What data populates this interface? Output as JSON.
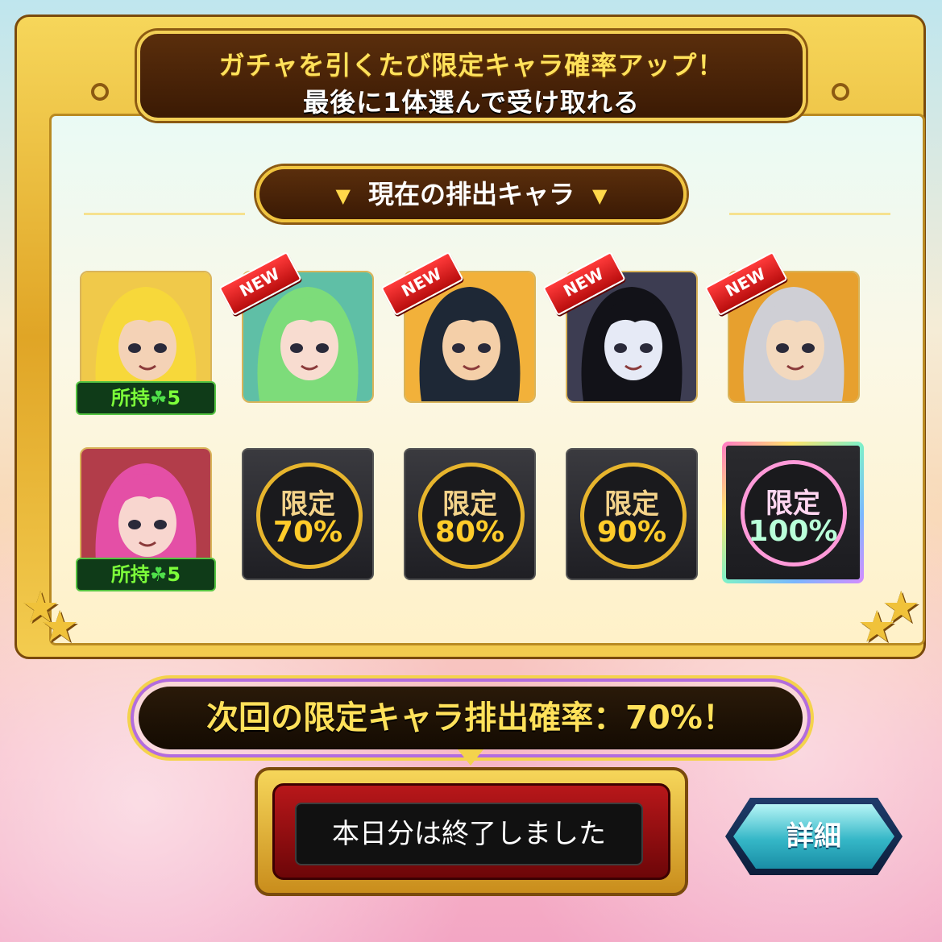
{
  "banner": {
    "line1": "ガチャを引くたび限定キャラ確率アップ！",
    "line2": "最後に1体選んで受け取れる"
  },
  "section_title": "現在の排出キャラ",
  "characters": [
    {
      "name": "char-yellow-hair",
      "owned": "所持",
      "owned_count": "5",
      "is_new": false,
      "bg": "#f0c94a",
      "hair": "#f7d83a",
      "skin": "#f4d2b6"
    },
    {
      "name": "char-green-hair",
      "is_new": true,
      "new_label": "NEW",
      "bg": "#5fbfa6",
      "hair": "#7ddc7a",
      "skin": "#f8dcd0"
    },
    {
      "name": "char-black-hair",
      "is_new": true,
      "new_label": "NEW",
      "bg": "#f2b13a",
      "hair": "#1e2836",
      "skin": "#f4cfa8"
    },
    {
      "name": "char-white-streak",
      "is_new": true,
      "new_label": "NEW",
      "bg": "#3d3d52",
      "hair": "#121218",
      "skin": "#e6eaf6"
    },
    {
      "name": "char-silver-hair",
      "is_new": true,
      "new_label": "NEW",
      "bg": "#e7a02e",
      "hair": "#cfcfd5",
      "skin": "#f3d9be"
    },
    {
      "name": "char-pink-duo",
      "owned": "所持",
      "owned_count": "5",
      "is_new": false,
      "bg": "#b23d4a",
      "hair": "#e44fa6",
      "skin": "#f8d6cf"
    }
  ],
  "locked_slots": [
    {
      "top": "限定",
      "bottom": "70%"
    },
    {
      "top": "限定",
      "bottom": "80%"
    },
    {
      "top": "限定",
      "bottom": "90%"
    },
    {
      "top": "限定",
      "bottom": "100%"
    }
  ],
  "next_rate_text": "次回の限定キャラ排出確率：70%！",
  "action_message": "本日分は終了しました",
  "detail_label": "詳細",
  "colors": {
    "gold": "#f3d056",
    "brown": "#3b1a04",
    "owned_green": "#7dff3a"
  }
}
